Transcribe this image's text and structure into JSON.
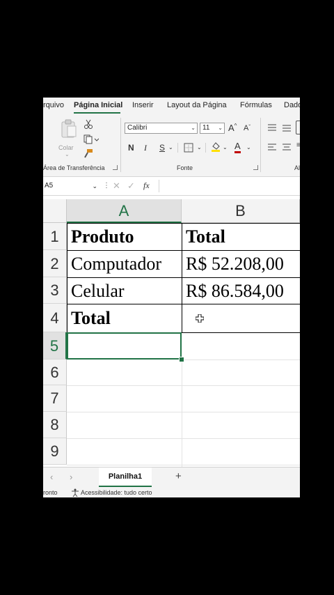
{
  "ribbon": {
    "tabs": [
      "rquivo",
      "Página Inicial",
      "Inserir",
      "Layout da Página",
      "Fórmulas",
      "Dado"
    ],
    "active_tab": "Página Inicial",
    "clipboard": {
      "paste_label": "Colar",
      "group_label": "Área de Transferência"
    },
    "font": {
      "name": "Calibri",
      "size": "11",
      "bold": "N",
      "italic": "I",
      "underline": "S",
      "grow": "A",
      "shrink": "A",
      "color_letter": "A",
      "group_label": "Fonte"
    },
    "alignment": {
      "group_label": "Al"
    }
  },
  "formula_bar": {
    "name_box": "A5",
    "fx_label": "fx",
    "value": ""
  },
  "grid": {
    "columns": [
      "A",
      "B"
    ],
    "rows": [
      "1",
      "2",
      "3",
      "4",
      "5",
      "6",
      "7",
      "8",
      "9"
    ],
    "cells": {
      "A1": "Produto",
      "B1": "Total",
      "A2": "Computador",
      "B2": "R$ 52.208,00",
      "A3": "Celular",
      "B3": "R$ 86.584,00",
      "A4": "Total",
      "B4": ""
    },
    "active_cell": "A5"
  },
  "sheets": {
    "tabs": [
      "Planilha1"
    ],
    "add_symbol": "+"
  },
  "status": {
    "ready": "ronto",
    "accessibility": "Acessibilidade: tudo certo"
  },
  "colors": {
    "accent": "#217346",
    "highlight": "#ffe000",
    "font_color": "#c00000"
  }
}
